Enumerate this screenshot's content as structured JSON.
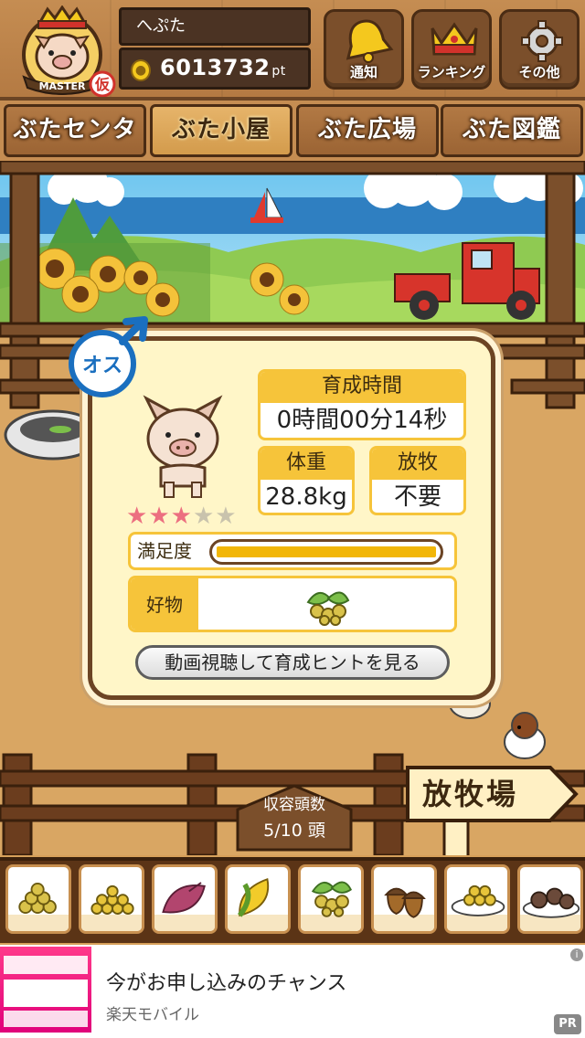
{
  "header": {
    "player_name": "へぷた",
    "points": "6013732",
    "points_unit": "pt",
    "badge_text": "MASTER",
    "badge_mark": "仮",
    "buttons": [
      {
        "label": "通知",
        "icon": "bell-icon"
      },
      {
        "label": "ランキング",
        "icon": "crown-icon"
      },
      {
        "label": "その他",
        "icon": "gear-icon"
      }
    ]
  },
  "tabs": [
    {
      "label": "ぶたセンター",
      "active": false
    },
    {
      "label": "ぶた小屋",
      "active": true
    },
    {
      "label": "ぶた広場",
      "active": false
    },
    {
      "label": "ぶた図鑑",
      "active": false
    }
  ],
  "pig_card": {
    "gender_label": "オス",
    "gender_symbol": "♂",
    "rating_filled": 3,
    "rating_total": 5,
    "raising_time_label": "育成時間",
    "raising_time_value": "0時間00分14秒",
    "weight_label": "体重",
    "weight_value": "28.8kg",
    "grazing_label": "放牧",
    "grazing_value": "不要",
    "satisfaction_label": "満足度",
    "satisfaction_level": 1.0,
    "favorite_label": "好物",
    "favorite_item_icon": "soybean-icon",
    "hint_button_label": "動画視聴して育成ヒントを見る"
  },
  "capacity": {
    "label": "収容頭数",
    "value": "5/10 頭"
  },
  "pasture_sign": "放牧場",
  "food_items": [
    {
      "icon": "grain-pile-icon"
    },
    {
      "icon": "yellow-grain-pile-icon"
    },
    {
      "icon": "sweet-potato-icon"
    },
    {
      "icon": "corn-icon"
    },
    {
      "icon": "soybean-icon"
    },
    {
      "icon": "acorn-icon"
    },
    {
      "icon": "grain-bowl-icon"
    },
    {
      "icon": "meatball-plate-icon"
    }
  ],
  "ad": {
    "title": "今がお申し込みのチャンス",
    "sponsor": "楽天モバイル",
    "info_label": "i",
    "pr_label": "PR"
  },
  "colors": {
    "card_bg": "#fff6c8",
    "card_accent": "#f6c43a",
    "wood_dark": "#6b4424",
    "star_on": "#ec6f80",
    "star_off": "#c9c3ad",
    "gender_blue": "#1a6fbf"
  }
}
